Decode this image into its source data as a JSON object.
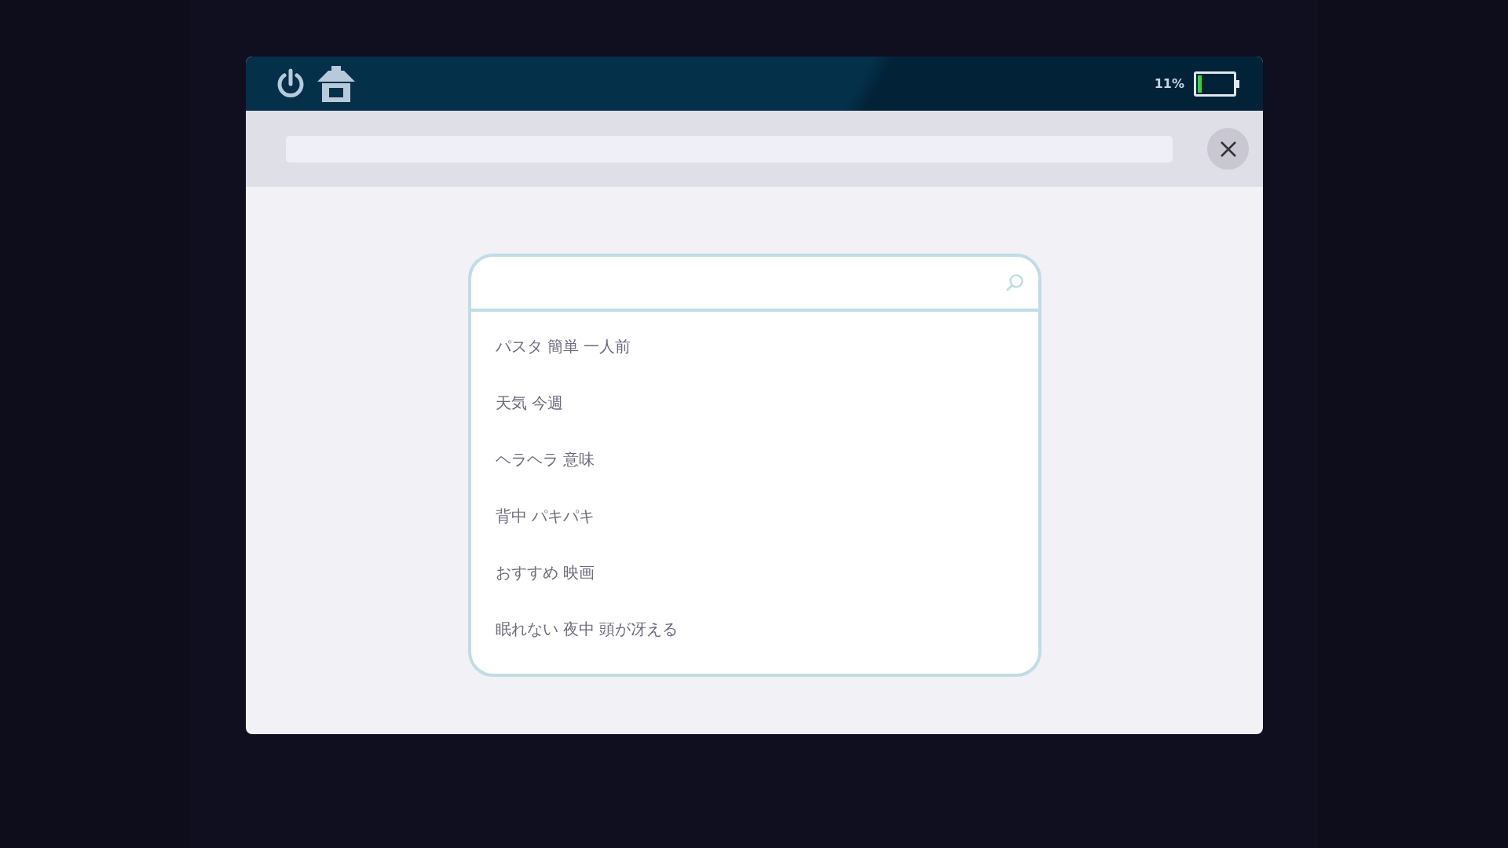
{
  "status_bar": {
    "battery_text": "11%",
    "battery": {
      "level": 0.11
    }
  },
  "search": {
    "suggestions": [
      {
        "text": "パスタ 簡単 一人前"
      },
      {
        "text": "天気 今週"
      },
      {
        "text": "ヘラヘラ 意味"
      },
      {
        "text": "背中 パキパキ"
      },
      {
        "text": "おすすめ 映画"
      },
      {
        "text": "眠れない 夜中 頭が冴える"
      }
    ]
  }
}
